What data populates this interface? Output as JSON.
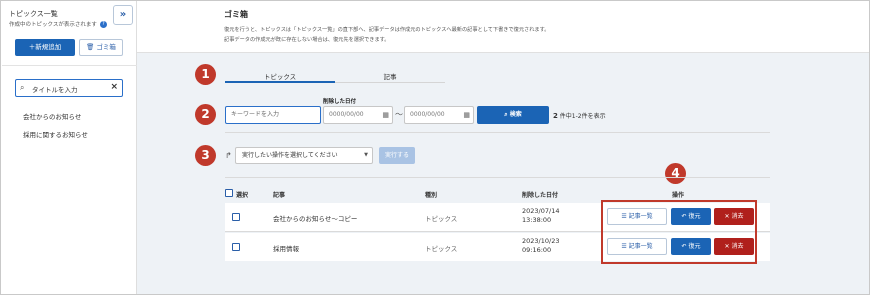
{
  "sidebar": {
    "title": "トピックス一覧",
    "subtitle": "作成中のトピックスが表示されます",
    "collapse_icon": "double-chevron-right-icon",
    "new_button": "＋新規追加",
    "trash_button": "ゴミ箱",
    "search": {
      "value": "タイトルを入力"
    },
    "items": [
      {
        "label": "会社からのお知らせ"
      },
      {
        "label": "採用に関するお知らせ"
      }
    ]
  },
  "header": {
    "title": "ゴミ箱",
    "desc_line1": "復元を行うと、トピックスは「トピックス一覧」の直下部へ、記事データは作成元のトピックスへ最新の記事として下書きで復元されます。",
    "desc_line2": "記事データの作成元が既に存在しない場合は、復元先を選択できます。"
  },
  "badges": [
    "1",
    "2",
    "3",
    "4"
  ],
  "tabs": [
    {
      "label": "トピックス",
      "active": true
    },
    {
      "label": "記事",
      "active": false
    }
  ],
  "filter": {
    "keyword_placeholder": "キーワードを入力",
    "date_label": "削除した日付",
    "date_from": "0000/00/00",
    "date_to": "0000/00/00",
    "tilde": "〜",
    "search_button": "検索",
    "count_number": "2",
    "count_text": "件中1-2件を表示"
  },
  "bulk": {
    "select_value": "実行したい操作を選択してください",
    "exec_button": "実行する"
  },
  "table": {
    "headers": {
      "select": "選択",
      "article": "記事",
      "type": "種別",
      "deleted_date": "削除した日付",
      "action": "操作"
    },
    "rows": [
      {
        "article": "会社からのお知らせ〜コピー",
        "type": "トピックス",
        "date": "2023/07/14",
        "time": "13:38:00"
      },
      {
        "article": "採用情報",
        "type": "トピックス",
        "date": "2023/10/23",
        "time": "09:16:00"
      }
    ],
    "actions": {
      "list": "記事一覧",
      "restore": "復元",
      "delete": "消去"
    }
  },
  "colors": {
    "primary": "#1b64b5",
    "danger": "#b0201c",
    "badge": "#c0392b",
    "page_bg": "#eef2f6"
  }
}
